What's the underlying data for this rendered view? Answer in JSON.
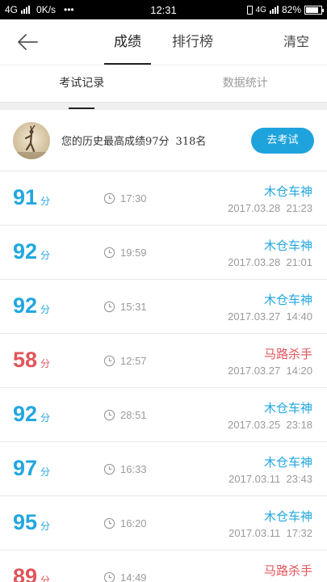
{
  "status_bar": {
    "network": "4G",
    "speed": "0K/s",
    "more": "•••",
    "time": "12:31",
    "network2": "4G",
    "battery": "82%",
    "battery_level": 0.82
  },
  "header": {
    "tabs": [
      {
        "label": "成绩",
        "active": true
      },
      {
        "label": "排行榜",
        "active": false
      }
    ],
    "clear_label": "清空"
  },
  "subtabs": [
    {
      "label": "考试记录",
      "active": true
    },
    {
      "label": "数据统计",
      "active": false
    }
  ],
  "best": {
    "text": "您的历史最高成绩97分",
    "rank": "318名",
    "button": "去考试"
  },
  "colors": {
    "accent": "#1fa3dc",
    "pass": "#22a7df",
    "fail": "#e0555b"
  },
  "records": [
    {
      "score": "91",
      "unit": "分",
      "duration": "17:30",
      "title": "木仓车神",
      "date": "2017.03.28  21:23",
      "status": "pass"
    },
    {
      "score": "92",
      "unit": "分",
      "duration": "19:59",
      "title": "木仓车神",
      "date": "2017.03.28  21:01",
      "status": "pass"
    },
    {
      "score": "92",
      "unit": "分",
      "duration": "15:31",
      "title": "木仓车神",
      "date": "2017.03.27  14:40",
      "status": "pass"
    },
    {
      "score": "58",
      "unit": "分",
      "duration": "12:57",
      "title": "马路杀手",
      "date": "2017.03.27  14:20",
      "status": "fail"
    },
    {
      "score": "92",
      "unit": "分",
      "duration": "28:51",
      "title": "木仓车神",
      "date": "2017.03.25  23:18",
      "status": "pass"
    },
    {
      "score": "97",
      "unit": "分",
      "duration": "16:33",
      "title": "木仓车神",
      "date": "2017.03.11  23:43",
      "status": "pass"
    },
    {
      "score": "95",
      "unit": "分",
      "duration": "16:20",
      "title": "木仓车神",
      "date": "2017.03.11  17:32",
      "status": "pass"
    },
    {
      "score": "89",
      "unit": "分",
      "duration": "14:49",
      "title": "马路杀手",
      "date": "",
      "status": "fail"
    }
  ]
}
